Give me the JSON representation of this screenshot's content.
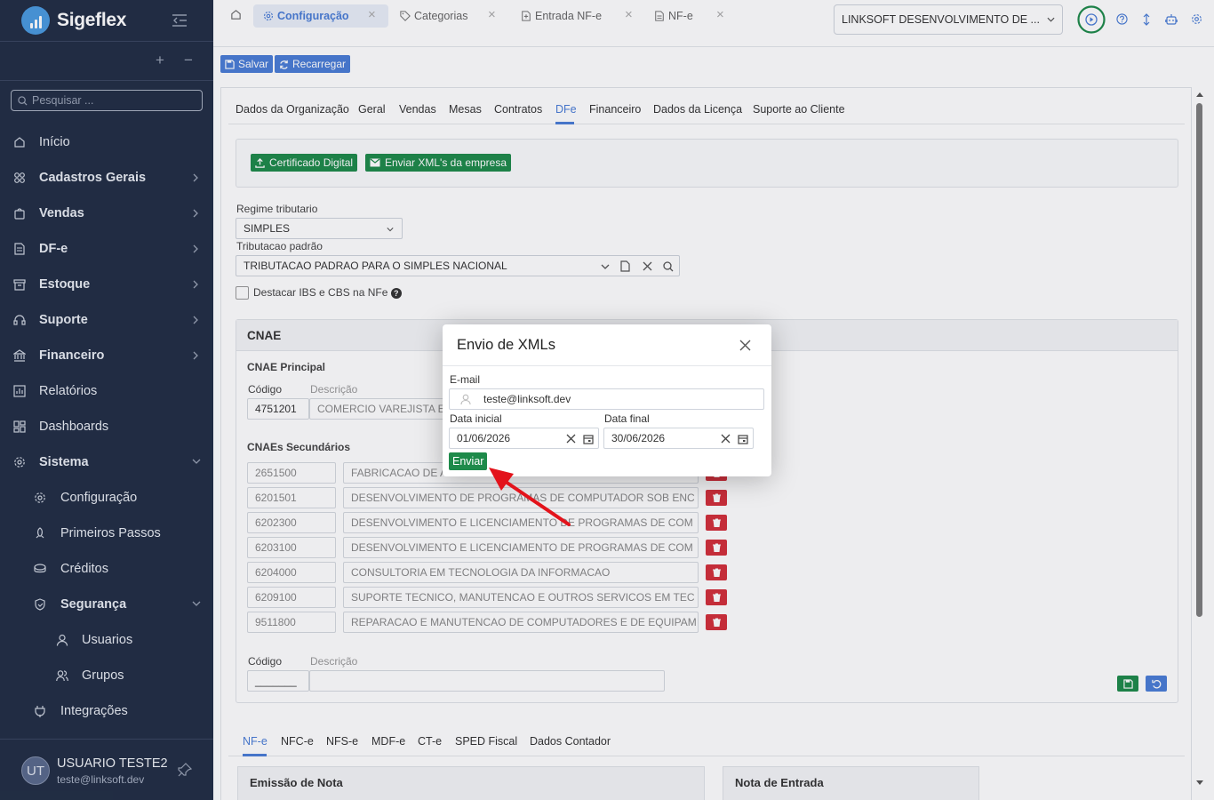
{
  "app": {
    "name": "Sigeflex"
  },
  "sidebar": {
    "search_placeholder": "Pesquisar ...",
    "items": [
      {
        "label": "Início",
        "icon": "home-icon",
        "bold": false
      },
      {
        "label": "Cadastros Gerais",
        "icon": "grid-icon",
        "bold": true
      },
      {
        "label": "Vendas",
        "icon": "bag-icon",
        "bold": true
      },
      {
        "label": "DF-e",
        "icon": "document-icon",
        "bold": true
      },
      {
        "label": "Estoque",
        "icon": "box-icon",
        "bold": true
      },
      {
        "label": "Suporte",
        "icon": "headset-icon",
        "bold": true
      },
      {
        "label": "Financeiro",
        "icon": "bank-icon",
        "bold": true
      },
      {
        "label": "Relatórios",
        "icon": "chart-icon",
        "bold": false
      },
      {
        "label": "Dashboards",
        "icon": "dashboard-icon",
        "bold": false
      },
      {
        "label": "Sistema",
        "icon": "gear-icon",
        "bold": true
      }
    ],
    "sistema_children": [
      {
        "label": "Configuração",
        "icon": "gear-icon"
      },
      {
        "label": "Primeiros Passos",
        "icon": "rocket-icon"
      },
      {
        "label": "Créditos",
        "icon": "coins-icon"
      },
      {
        "label": "Segurança",
        "icon": "shield-icon"
      }
    ],
    "seguranca_children": [
      {
        "label": "Usuarios",
        "icon": "user-icon"
      },
      {
        "label": "Grupos",
        "icon": "users-icon"
      }
    ],
    "integracoes": "Integrações",
    "user": {
      "initials": "UT",
      "name": "USUARIO TESTE2",
      "email": "teste@linksoft.dev"
    }
  },
  "tabs": [
    {
      "label": "Configuração",
      "icon": "gear-icon"
    },
    {
      "label": "Categorias",
      "icon": "tag-icon"
    },
    {
      "label": "Entrada NF-e",
      "icon": "file-plus-icon"
    },
    {
      "label": "NF-e",
      "icon": "file-icon"
    }
  ],
  "company_select": "LINKSOFT DESENVOLVIMENTO DE ...",
  "toolbar": {
    "save": "Salvar",
    "reload": "Recarregar"
  },
  "config_tabs": [
    "Dados da Organização",
    "Geral",
    "Vendas",
    "Mesas",
    "Contratos",
    "DFe",
    "Financeiro",
    "Dados da Licença",
    "Suporte ao Cliente"
  ],
  "dfe": {
    "cert_button": "Certificado Digital",
    "send_xml_button": "Enviar XML's da empresa",
    "regime_label": "Regime tributario",
    "regime_value": "SIMPLES",
    "trib_label": "Tributacao padrão",
    "trib_value": "TRIBUTACAO PADRAO PARA O SIMPLES NACIONAL",
    "ibs_label": "Destacar IBS e CBS na NFe",
    "cnae": {
      "title": "CNAE",
      "principal_title": "CNAE Principal",
      "code_label": "Código",
      "desc_label": "Descrição",
      "principal_code": "4751201",
      "principal_desc": "COMERCIO VAREJISTA E",
      "secundarios_title": "CNAEs Secundários",
      "secundarios": [
        {
          "code": "2651500",
          "desc": "FABRICACAO DE A"
        },
        {
          "code": "6201501",
          "desc": "DESENVOLVIMENTO DE PROGRAMAS DE COMPUTADOR SOB ENC"
        },
        {
          "code": "6202300",
          "desc": "DESENVOLVIMENTO E LICENCIAMENTO DE PROGRAMAS DE COM"
        },
        {
          "code": "6203100",
          "desc": "DESENVOLVIMENTO E LICENCIAMENTO DE PROGRAMAS DE COM"
        },
        {
          "code": "6204000",
          "desc": "CONSULTORIA EM TECNOLOGIA DA INFORMACAO"
        },
        {
          "code": "6209100",
          "desc": "SUPORTE TECNICO, MANUTENCAO E OUTROS SERVICOS EM TEC"
        },
        {
          "code": "9511800",
          "desc": "REPARACAO E MANUTENCAO DE COMPUTADORES E DE EQUIPAM"
        }
      ],
      "new_code_label": "Código",
      "new_desc_label": "Descrição",
      "new_code_mask": "_______"
    },
    "bottom_tabs": [
      "NF-e",
      "NFC-e",
      "NFS-e",
      "MDF-e",
      "CT-e",
      "SPED Fiscal",
      "Dados Contador"
    ],
    "emissao_title": "Emissão de Nota",
    "entrada_title": "Nota de Entrada"
  },
  "modal": {
    "title": "Envio de XMLs",
    "email_label": "E-mail",
    "email_value": "teste@linksoft.dev",
    "start_label": "Data inicial",
    "start_value": "01/06/2026",
    "end_label": "Data final",
    "end_value": "30/06/2026",
    "send_button": "Enviar"
  },
  "colors": {
    "sidebar_bg": "#222e45",
    "accent": "#4a7dd6",
    "green": "#1e8a4a",
    "danger": "#d32f3a",
    "annotation_arrow": "#e3131b"
  }
}
